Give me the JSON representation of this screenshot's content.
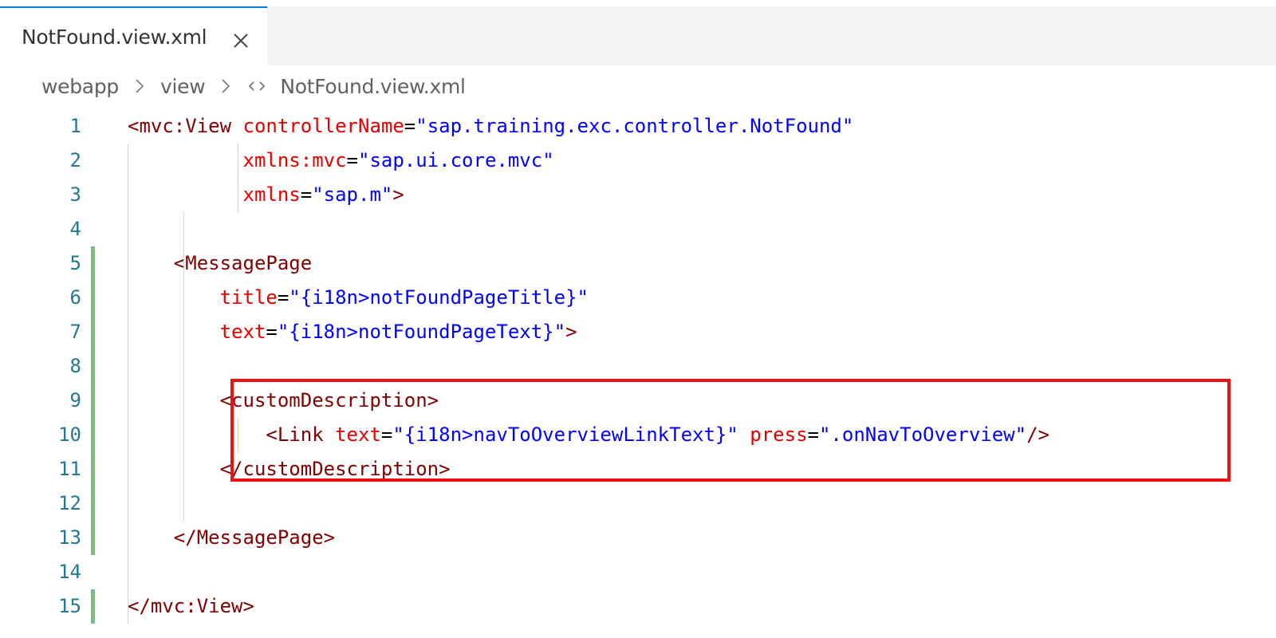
{
  "tab": {
    "label": "NotFound.view.xml",
    "close_icon": "close-icon"
  },
  "breadcrumb": {
    "items": [
      "webapp",
      "view",
      "NotFound.view.xml"
    ],
    "file_icon": "xml-file-icon"
  },
  "editor": {
    "colors": {
      "tag": "#800000",
      "attribute": "#e50000",
      "value": "#0000ff",
      "line_number": "#237893",
      "git_modified": "#81b88b",
      "highlight_box": "#ee1111"
    },
    "lines": [
      {
        "n": "1",
        "code": [
          [
            "t-tag",
            "<mvc:View "
          ],
          [
            "t-attr",
            "controllerName"
          ],
          [
            "t-eq",
            "="
          ],
          [
            "t-val",
            "\"sap.training.exc.controller.NotFound\""
          ]
        ]
      },
      {
        "n": "2",
        "code": [
          [
            "t-tag",
            "          "
          ],
          [
            "t-attr",
            "xmlns:mvc"
          ],
          [
            "t-eq",
            "="
          ],
          [
            "t-val",
            "\"sap.ui.core.mvc\""
          ]
        ]
      },
      {
        "n": "3",
        "code": [
          [
            "t-tag",
            "          "
          ],
          [
            "t-attr",
            "xmlns"
          ],
          [
            "t-eq",
            "="
          ],
          [
            "t-val",
            "\"sap.m\""
          ],
          [
            "t-tag",
            ">"
          ]
        ]
      },
      {
        "n": "4",
        "code": []
      },
      {
        "n": "5",
        "code": [
          [
            "t-tag",
            "    <MessagePage"
          ]
        ]
      },
      {
        "n": "6",
        "code": [
          [
            "t-tag",
            "        "
          ],
          [
            "t-attr",
            "title"
          ],
          [
            "t-eq",
            "="
          ],
          [
            "t-val",
            "\"{i18n>notFoundPageTitle}\""
          ]
        ]
      },
      {
        "n": "7",
        "code": [
          [
            "t-tag",
            "        "
          ],
          [
            "t-attr",
            "text"
          ],
          [
            "t-eq",
            "="
          ],
          [
            "t-val",
            "\"{i18n>notFoundPageText}\""
          ],
          [
            "t-tag",
            ">"
          ]
        ]
      },
      {
        "n": "8",
        "code": []
      },
      {
        "n": "9",
        "code": [
          [
            "t-tag",
            "        <customDescription>"
          ]
        ]
      },
      {
        "n": "10",
        "code": [
          [
            "t-tag",
            "            <Link "
          ],
          [
            "t-attr",
            "text"
          ],
          [
            "t-eq",
            "="
          ],
          [
            "t-val",
            "\"{i18n>navToOverviewLinkText}\""
          ],
          [
            "t-tag",
            " "
          ],
          [
            "t-attr",
            "press"
          ],
          [
            "t-eq",
            "="
          ],
          [
            "t-val",
            "\".onNavToOverview\""
          ],
          [
            "t-tag",
            "/>"
          ]
        ]
      },
      {
        "n": "11",
        "code": [
          [
            "t-tag",
            "        </customDescription>"
          ]
        ]
      },
      {
        "n": "12",
        "code": []
      },
      {
        "n": "13",
        "code": [
          [
            "t-tag",
            "    </MessagePage>"
          ]
        ]
      },
      {
        "n": "14",
        "code": []
      },
      {
        "n": "15",
        "code": [
          [
            "t-tag",
            "</mvc:View>"
          ]
        ]
      }
    ],
    "modified_lines": [
      "5",
      "6",
      "7",
      "8",
      "9",
      "10",
      "11",
      "12",
      "13",
      "15"
    ]
  }
}
